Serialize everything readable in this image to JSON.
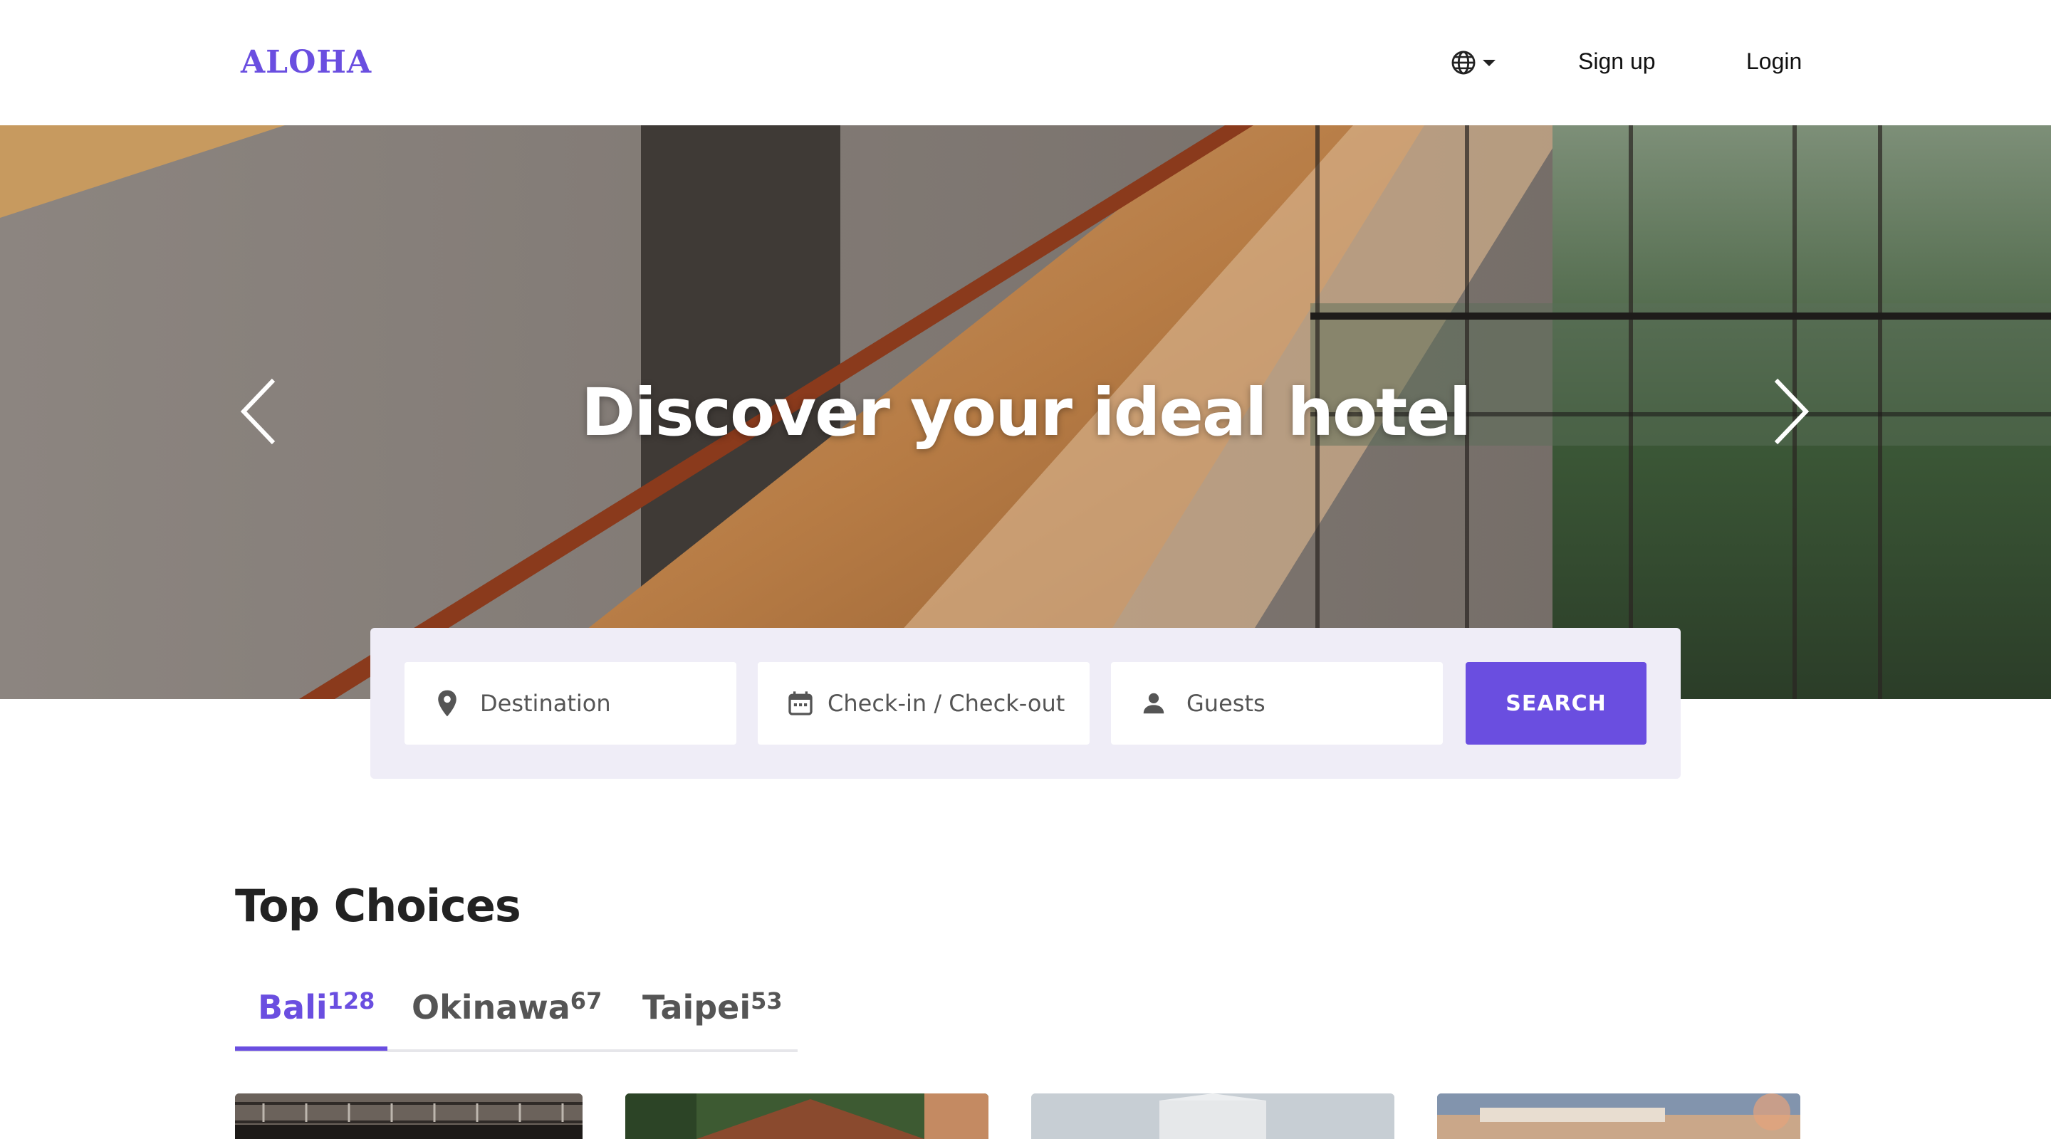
{
  "header": {
    "logo": "ALOHA",
    "language_icon": "globe-icon",
    "signup_label": "Sign up",
    "login_label": "Login"
  },
  "hero": {
    "title": "Discover your ideal hotel",
    "prev_icon": "chevron-left-icon",
    "next_icon": "chevron-right-icon"
  },
  "search": {
    "destination_placeholder": "Destination",
    "dates_placeholder": "Check-in / Check-out",
    "guests_placeholder": "Guests",
    "button_label": "SEARCH"
  },
  "top_choices": {
    "title": "Top Choices",
    "tabs": [
      {
        "label": "Bali",
        "count": "128",
        "active": true
      },
      {
        "label": "Okinawa",
        "count": "67",
        "active": false
      },
      {
        "label": "Taipei",
        "count": "53",
        "active": false
      }
    ]
  },
  "colors": {
    "accent": "#6a4ee0",
    "panel": "#efedf7"
  }
}
